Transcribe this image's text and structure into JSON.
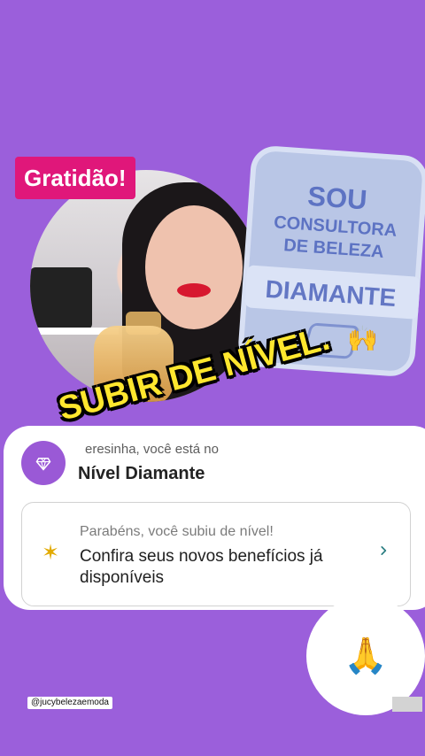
{
  "story": {
    "title_tag": "Gratidão!",
    "badge": {
      "line1": "SOU",
      "line2": "CONSULTORA",
      "line3": "DE BELEZA",
      "line4": "DIAMANTE",
      "icon": "diamond-icon"
    },
    "headline": "SUBIR DE NÍVEL.",
    "raised_hands_emoji": "🙌",
    "handle": "@jucybelezaemoda",
    "pray_emoji": "🙏"
  },
  "card": {
    "greeting": "eresinha, você está no",
    "level": "Nível Diamante",
    "notification": {
      "title": "Parabéns, você subiu de nível!",
      "body": "Confira seus novos benefícios já disponíveis"
    },
    "icons": {
      "gem": "diamond-icon",
      "sparkle": "sparkle-icon",
      "chevron": "chevron-right-icon"
    },
    "colors": {
      "accent": "#9b5fdb",
      "star": "#e2aa00"
    }
  }
}
